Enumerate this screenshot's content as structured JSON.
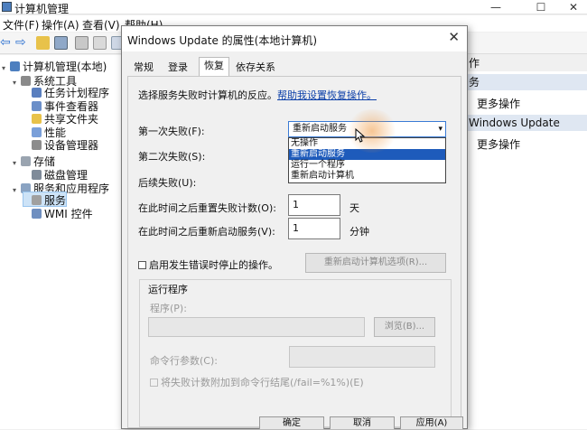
{
  "app": {
    "title": "计算机管理"
  },
  "menu": [
    "文件(F)",
    "操作(A)",
    "查看(V)",
    "帮助(H)"
  ],
  "tree": [
    {
      "label": "计算机管理(本地)",
      "level": 0,
      "icon": "computer-icon"
    },
    {
      "label": "系统工具",
      "level": 1,
      "icon": "tools-icon"
    },
    {
      "label": "任务计划程序",
      "level": 2,
      "icon": "clock-icon"
    },
    {
      "label": "事件查看器",
      "level": 2,
      "icon": "event-viewer-icon"
    },
    {
      "label": "共享文件夹",
      "level": 2,
      "icon": "folder-icon"
    },
    {
      "label": "性能",
      "level": 2,
      "icon": "performance-icon"
    },
    {
      "label": "设备管理器",
      "level": 2,
      "icon": "device-manager-icon"
    },
    {
      "label": "存储",
      "level": 1,
      "icon": "storage-icon"
    },
    {
      "label": "磁盘管理",
      "level": 2,
      "icon": "disk-icon"
    },
    {
      "label": "服务和应用程序",
      "level": 1,
      "icon": "services-apps-icon"
    },
    {
      "label": "服务",
      "level": 2,
      "icon": "services-icon",
      "selected": true
    },
    {
      "label": "WMI 控件",
      "level": 2,
      "icon": "wmi-icon"
    }
  ],
  "right_pane": {
    "header1": "作",
    "section1": "务",
    "item1": "更多操作",
    "section2": "Windows Update",
    "item2": "更多操作"
  },
  "dialog": {
    "title": "Windows Update 的属性(本地计算机)",
    "tabs": [
      "常规",
      "登录",
      "恢复",
      "依存关系"
    ],
    "active_tab": "恢复",
    "intro": "选择服务失败时计算机的反应。",
    "intro_link": "帮助我设置恢复操作。",
    "first_failure_label": "第一次失败(F):",
    "first_failure_value": "重新启动服务",
    "dropdown_options": [
      "无操作",
      "重新启动服务",
      "运行一个程序",
      "重新启动计算机"
    ],
    "dropdown_selected": "重新启动服务",
    "second_failure_label": "第二次失败(S):",
    "subsequent_failure_label": "后续失败(U):",
    "reset_count_label": "在此时间之后重置失败计数(O):",
    "reset_count_value": "1",
    "reset_count_unit": "天",
    "restart_service_label": "在此时间之后重新启动服务(V):",
    "restart_service_value": "1",
    "restart_service_unit": "分钟",
    "enable_actions_label": "启用发生错误时停止的操作。",
    "restart_options_button": "重新启动计算机选项(R)...",
    "run_program_group": "运行程序",
    "program_label": "程序(P):",
    "browse_button": "浏览(B)...",
    "cmd_params_label": "命令行参数(C):",
    "append_fail_label": "将失败计数附加到命令行结尾(/fail=%1%)(E)",
    "ok_button": "确定",
    "cancel_button": "取消",
    "apply_button": "应用(A)"
  }
}
